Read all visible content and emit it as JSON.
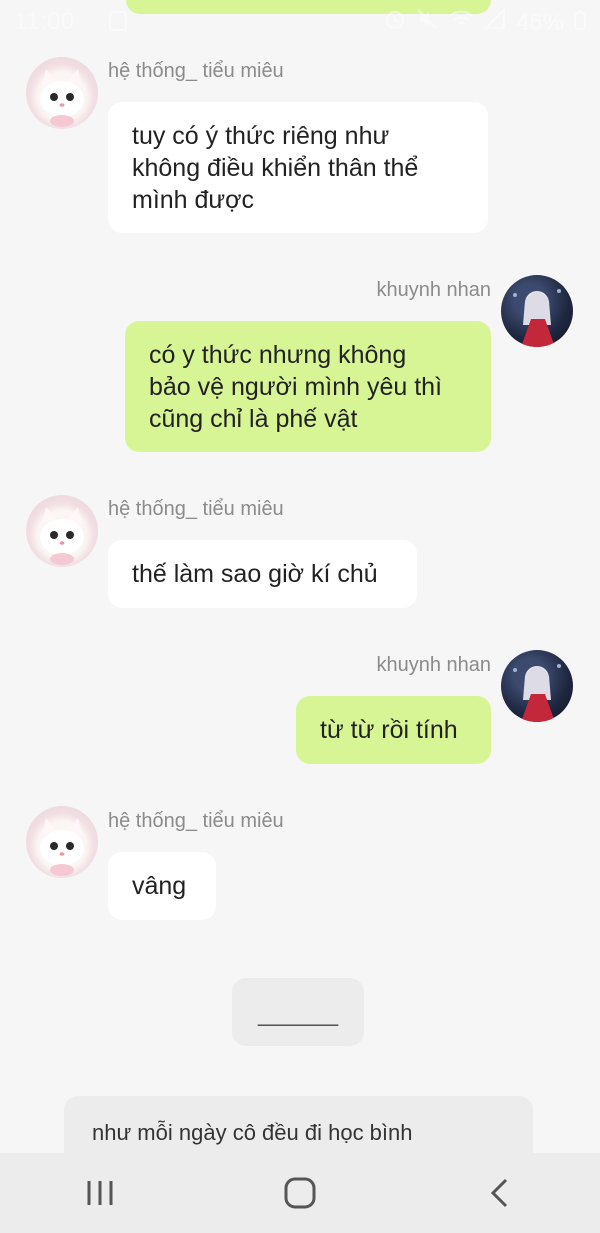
{
  "status_bar": {
    "time": "11:00",
    "battery": "46%",
    "icons": [
      "screenshot-icon",
      "alarm-icon",
      "mute-icon",
      "wifi-icon",
      "signal-icon",
      "battery-icon"
    ]
  },
  "messages": [
    {
      "side": "left",
      "sender": "hệ thống_ tiểu miêu",
      "lines": [
        "tuy có ý thức riêng như",
        "không điều khiển thân thể",
        "mình được"
      ]
    },
    {
      "side": "right",
      "sender": "khuynh nhan",
      "lines": [
        "có y thức nhưng không",
        "bảo vệ người mình yêu thì",
        "cũng chỉ là phế vật"
      ]
    },
    {
      "side": "left",
      "sender": "hệ thống_ tiểu miêu",
      "lines": [
        "thế làm sao giờ kí chủ"
      ]
    },
    {
      "side": "right",
      "sender": "khuynh nhan",
      "lines": [
        "từ từ rồi tính"
      ]
    },
    {
      "side": "left",
      "sender": "hệ thống_ tiểu miêu",
      "lines": [
        "vâng"
      ]
    }
  ],
  "divider": "______",
  "narration": {
    "line1": "như mỗi ngày cô đều đi học bình"
  },
  "colors": {
    "background": "#f6f6f6",
    "bubble_green": "#d7f595",
    "bubble_white": "#ffffff",
    "name_gray": "#8b8b8b"
  }
}
